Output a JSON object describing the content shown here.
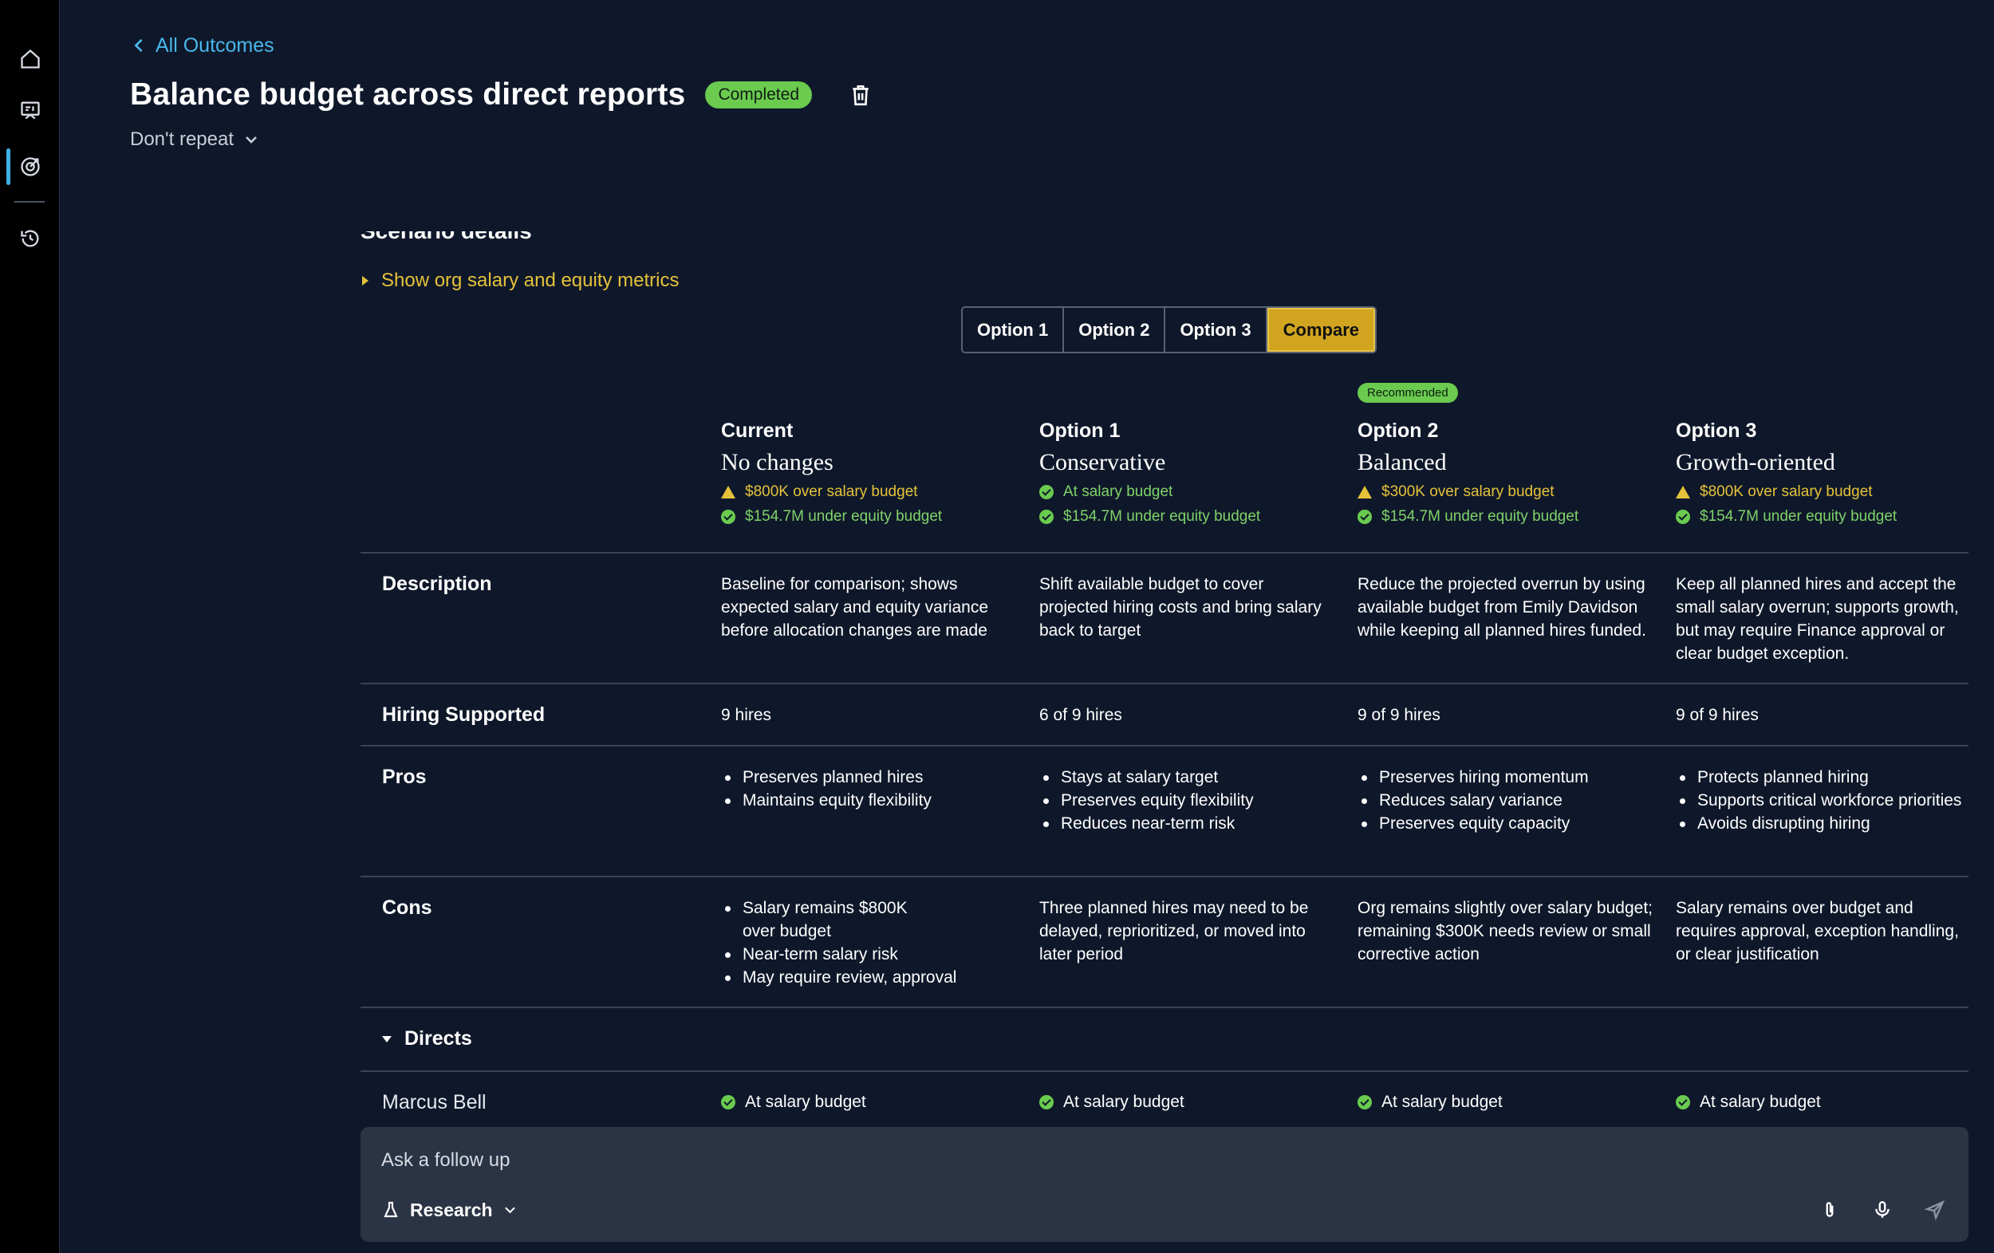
{
  "nav": {
    "items": [
      {
        "icon": "home-icon"
      },
      {
        "icon": "presentation-icon"
      },
      {
        "icon": "target-icon",
        "active": true
      },
      {
        "icon": "history-icon"
      }
    ]
  },
  "header": {
    "back_label": "All Outcomes",
    "title": "Balance budget across direct reports",
    "status": "Completed",
    "repeat": "Don't repeat"
  },
  "scenario": {
    "heading": "Scenario details",
    "metrics_toggle": "Show org salary and equity metrics",
    "tabs": [
      "Option 1",
      "Option 2",
      "Option 3",
      "Compare"
    ],
    "active_tab": "Compare"
  },
  "columns": [
    {
      "title": "Current",
      "subtitle": "No changes",
      "salary": "$800K over salary budget",
      "salary_state": "warn",
      "equity": "$154.7M under equity budget",
      "badge": ""
    },
    {
      "title": "Option 1",
      "subtitle": "Conservative",
      "salary": "At salary budget",
      "salary_state": "ok",
      "equity": "$154.7M under equity budget",
      "badge": ""
    },
    {
      "title": "Option 2",
      "subtitle": "Balanced",
      "salary": "$300K over salary budget",
      "salary_state": "warn",
      "equity": "$154.7M under equity budget",
      "badge": "Recommended"
    },
    {
      "title": "Option 3",
      "subtitle": "Growth-oriented",
      "salary": "$800K over salary budget",
      "salary_state": "warn",
      "equity": "$154.7M under equity budget",
      "badge": ""
    }
  ],
  "rows": {
    "description": {
      "label": "Description",
      "cells": [
        "Baseline for comparison; shows expected salary and equity variance before allocation changes are made",
        "Shift available budget to cover projected hiring costs and bring salary back to target",
        "Reduce the projected overrun by using available budget from Emily Davidson while keeping all planned hires funded.",
        "Keep all planned hires and accept the small salary overrun; supports growth, but may require Finance approval or clear budget exception."
      ]
    },
    "hiring": {
      "label": "Hiring Supported",
      "cells": [
        "9 hires",
        "6 of 9 hires",
        "9 of 9 hires",
        "9 of 9 hires"
      ]
    },
    "pros": {
      "label": "Pros",
      "cells": [
        [
          "Preserves planned hires",
          "Maintains equity flexibility"
        ],
        [
          "Stays at salary target",
          "Preserves equity flexibility",
          "Reduces near-term risk"
        ],
        [
          "Preserves hiring momentum",
          "Reduces salary variance",
          "Preserves equity capacity"
        ],
        [
          "Protects planned hiring",
          "Supports critical workforce priorities",
          "Avoids disrupting hiring"
        ]
      ]
    },
    "cons": {
      "label": "Cons",
      "cells": [
        [
          "Salary remains $800K over budget",
          "Near-term salary risk",
          "May require review, approval"
        ],
        "Three planned hires may need to be delayed, reprioritized, or moved into later period",
        "Org remains slightly over salary budget; remaining $300K needs review or small corrective action",
        "Salary remains over budget and requires approval, exception handling, or clear justification"
      ]
    }
  },
  "directs": {
    "label": "Directs",
    "people": [
      {
        "name": "Marcus Bell",
        "statuses": [
          "At salary budget",
          "At salary budget",
          "At salary budget",
          "At salary budget"
        ]
      }
    ]
  },
  "composer": {
    "placeholder": "Ask a follow up",
    "mode": "Research"
  },
  "colors": {
    "accent_blue": "#49b7ec",
    "warn_yellow": "#e5c23a",
    "ok_green": "#6acb4f",
    "active_tab": "#d1a520"
  }
}
